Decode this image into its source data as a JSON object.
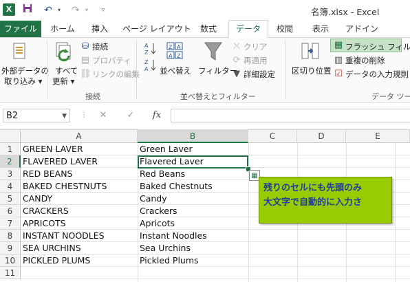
{
  "titlebar": {
    "app_icon": "X",
    "doc_title": "名簿.xlsx - Excel"
  },
  "tabs": [
    "ファイル",
    "ホーム",
    "挿入",
    "ページ レイアウト",
    "数式",
    "データ",
    "校閲",
    "表示",
    "アドイン"
  ],
  "ribbon": {
    "get_external": [
      "外部データの",
      "取り込み ▾"
    ],
    "refresh_all": [
      "すべて",
      "更新 ▾"
    ],
    "connections": "接続",
    "properties": "プロパティ",
    "edit_links": "リンクの編集",
    "group_connections": "接続",
    "sort": "並べ替え",
    "filter": "フィルター",
    "clear": "クリア",
    "reapply": "再適用",
    "advanced": "詳細設定",
    "group_sort_filter": "並べ替えとフィルター",
    "text_to_columns": "区切り位置",
    "flash_fill": "フラッシュ フィル",
    "remove_duplicates": "重複の削除",
    "data_validation": "データの入力規則",
    "group_data_tools": "データ ツー"
  },
  "formula_bar": {
    "name_box": "B2",
    "fx": "fx"
  },
  "grid": {
    "columns": [
      "A",
      "B",
      "C",
      "D",
      "E"
    ],
    "rows": [
      "1",
      "2",
      "3",
      "4",
      "5",
      "6",
      "7",
      "8",
      "9",
      "10",
      "11"
    ],
    "colA": [
      "GREEN LAVER",
      "FLAVERED LAVER",
      "RED BEANS",
      "BAKED CHESTNUTS",
      "CANDY",
      "CRACKERS",
      "APRICOTS",
      "INSTANT NOODLES",
      "SEA URCHINS",
      "PICKLED PLUMS"
    ],
    "colB": [
      "Green Laver",
      "Flavered Laver",
      "Red Beans",
      "Baked Chestnuts",
      "Candy",
      "Crackers",
      "Apricots",
      "Instant Noodles",
      "Sea Urchins",
      "Pickled Plums"
    ]
  },
  "callout": {
    "line1": "残りのセルにも先頭のみ",
    "line2": "大文字で自動的に入力さ"
  },
  "colors": {
    "accent": "#217346",
    "callout_bg": "#99cc00",
    "callout_text": "#1f3d99"
  }
}
